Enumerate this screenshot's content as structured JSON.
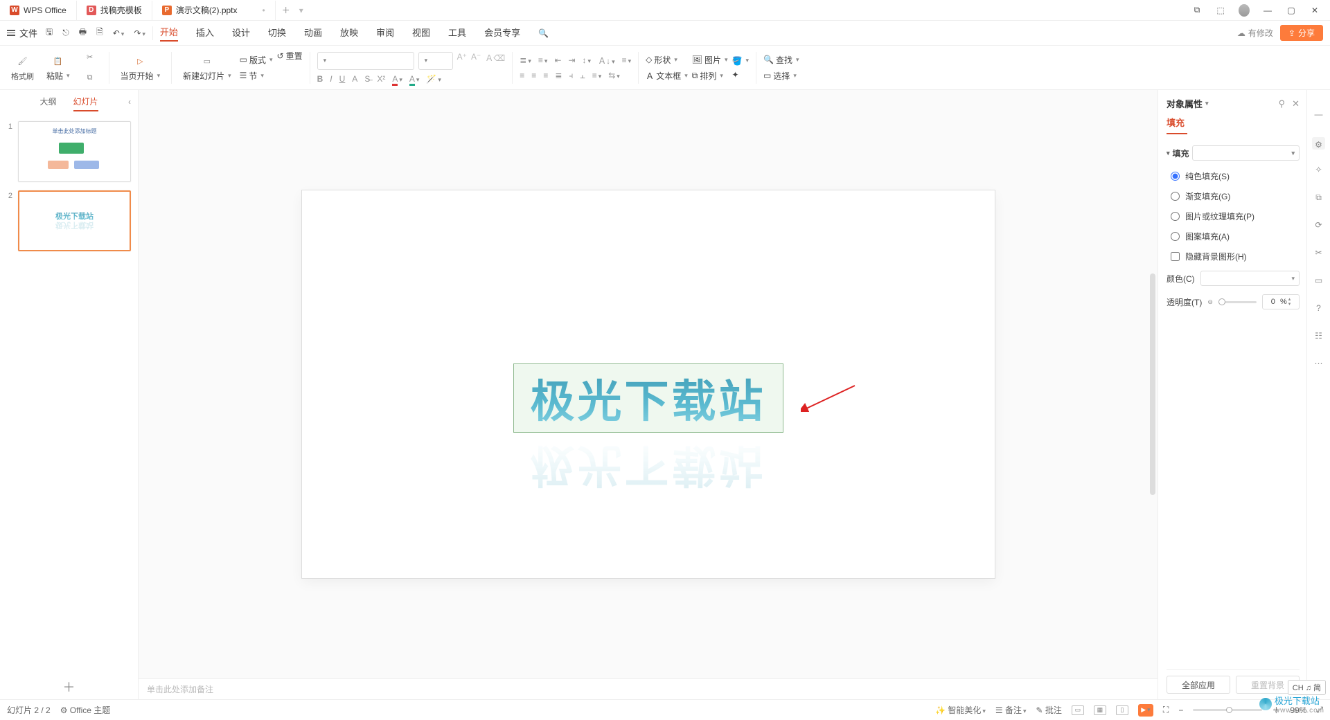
{
  "tabs": {
    "t1": "WPS Office",
    "t2": "找稿壳模板",
    "t3": "演示文稿(2).pptx"
  },
  "file_menu": "文件",
  "menus": {
    "start": "开始",
    "insert": "插入",
    "design": "设计",
    "trans": "切换",
    "anim": "动画",
    "show": "放映",
    "review": "审阅",
    "view": "视图",
    "tools": "工具",
    "vip": "会员专享"
  },
  "topright": {
    "modify": "有修改",
    "share": "分享"
  },
  "ribbon": {
    "fmt": "格式刷",
    "paste": "粘贴",
    "curpage": "当页开始",
    "newslide": "新建幻灯片",
    "layout": "版式",
    "section": "节",
    "reset": "重置",
    "shape": "形状",
    "pic": "图片",
    "textbox": "文本框",
    "arrange": "排列",
    "find": "查找",
    "select": "选择"
  },
  "left_tabs": {
    "outline": "大纲",
    "slides": "幻灯片"
  },
  "thumb1_title": "单击此处添加标题",
  "canvas_text": "极光下载站",
  "notes_hint": "单击此处添加备注",
  "prop": {
    "title": "对象属性",
    "tab": "填充",
    "section": "填充",
    "solid": "纯色填充(S)",
    "grad": "渐变填充(G)",
    "tex": "图片或纹理填充(P)",
    "pat": "图案填充(A)",
    "hidebg": "隐藏背景图形(H)",
    "color": "颜色(C)",
    "opacity": "透明度(T)",
    "opv": "0",
    "oppct": "%",
    "applyall": "全部应用",
    "resetbg": "重置背景"
  },
  "status": {
    "page": "幻灯片 2 / 2",
    "theme": "Office 主题",
    "smart": "智能美化",
    "notes": "备注",
    "comment": "批注",
    "zoom": "99%"
  },
  "ime": "CH ♫ 简",
  "watermark": "极光下载站",
  "watermark_sub": "www.xz7.com"
}
